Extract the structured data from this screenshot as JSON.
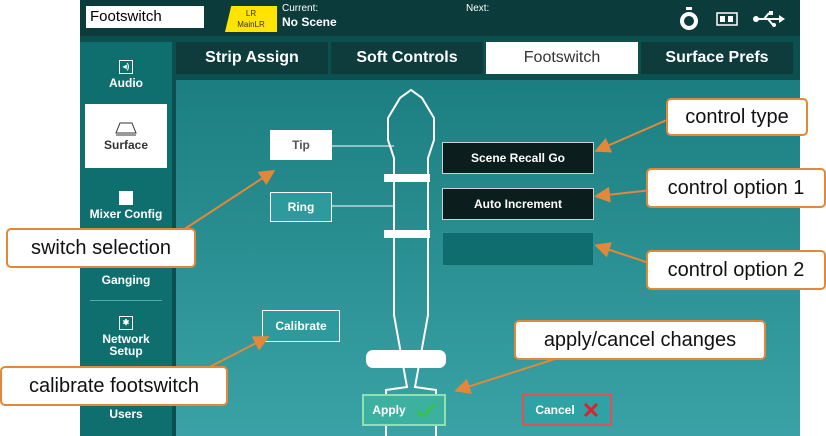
{
  "topbar": {
    "title": "Footswitch",
    "badge_top": "LR",
    "badge_bottom": "MainLR",
    "current_label": "Current:",
    "current_value": "No Scene",
    "next_label": "Next:"
  },
  "tabs": [
    {
      "label": "Strip Assign",
      "active": false
    },
    {
      "label": "Soft Controls",
      "active": false
    },
    {
      "label": "Footswitch",
      "active": true
    },
    {
      "label": "Surface Prefs",
      "active": false
    }
  ],
  "sidebar": {
    "items": [
      {
        "label": "Audio",
        "icon": "speaker-icon"
      },
      {
        "label": "Surface",
        "icon": "surface-icon"
      },
      {
        "label": "Mixer Config",
        "icon": "mixer-config-icon"
      },
      {
        "label": "Ganging",
        "icon": "ganging-icon"
      },
      {
        "label": "Network Setup",
        "icon": "network-icon"
      },
      {
        "label": "Users",
        "icon": "users-icon"
      }
    ]
  },
  "footswitch": {
    "tip_label": "Tip",
    "ring_label": "Ring",
    "calibrate_label": "Calibrate",
    "control_type_value": "Scene Recall Go",
    "control_option1_value": "Auto Increment",
    "control_option2_value": "",
    "apply_label": "Apply",
    "cancel_label": "Cancel"
  },
  "callouts": {
    "control_type": "control type",
    "control_option_1": "control option 1",
    "control_option_2": "control option 2",
    "switch_selection": "switch selection",
    "apply_cancel": "apply/cancel changes",
    "calibrate": "calibrate footswitch"
  },
  "colors": {
    "accent_orange": "#e2883a",
    "panel_teal": "#1c7e80",
    "badge_yellow": "#ffe400",
    "apply_check": "#36c24b",
    "cancel_x": "#e0202a"
  }
}
